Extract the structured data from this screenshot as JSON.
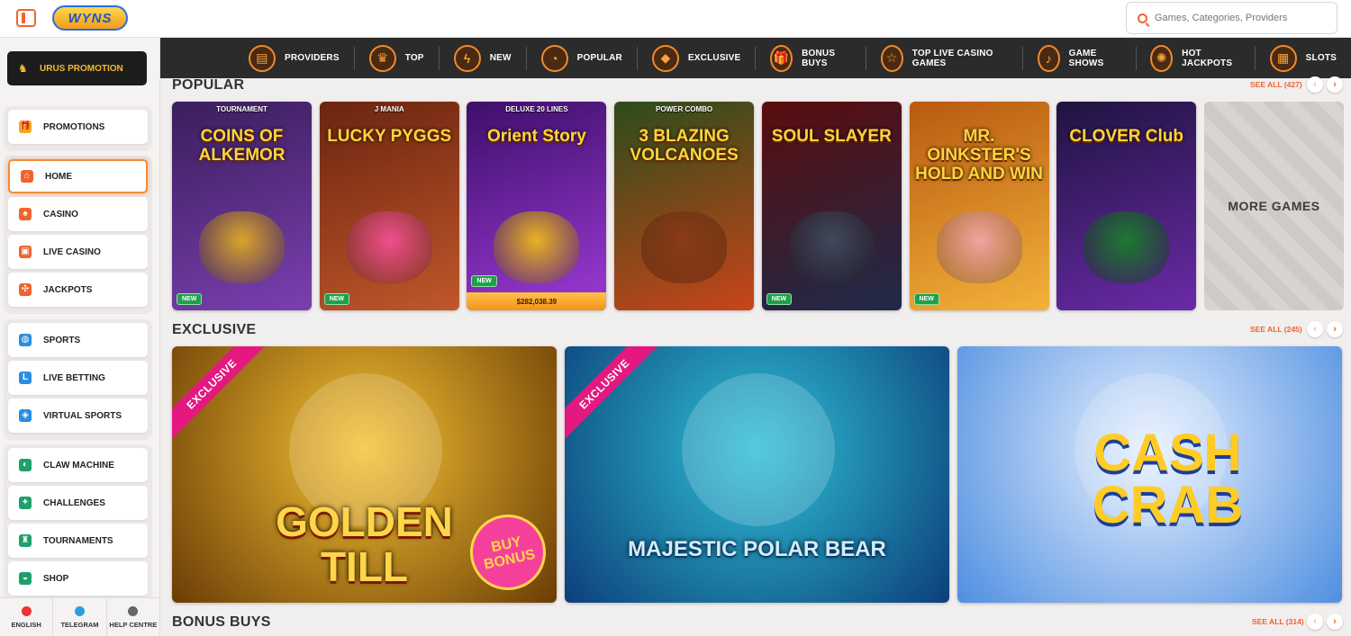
{
  "brand": {
    "logo_text": "WYNS"
  },
  "search": {
    "placeholder": "Games, Categories, Providers"
  },
  "sidebar": {
    "promo_label": "URUS PROMOTION",
    "groups": [
      [
        {
          "label": "PROMOTIONS",
          "icon": "gift-icon"
        }
      ],
      [
        {
          "label": "HOME",
          "icon": "home-icon",
          "active": true
        },
        {
          "label": "CASINO",
          "icon": "casino-icon"
        },
        {
          "label": "LIVE CASINO",
          "icon": "live-casino-icon"
        },
        {
          "label": "JACKPOTS",
          "icon": "clover-icon"
        }
      ],
      [
        {
          "label": "SPORTS",
          "icon": "ball-icon"
        },
        {
          "label": "LIVE BETTING",
          "icon": "live-icon"
        },
        {
          "label": "VIRTUAL SPORTS",
          "icon": "virtual-icon"
        }
      ],
      [
        {
          "label": "CLAW MACHINE",
          "icon": "claw-icon"
        },
        {
          "label": "CHALLENGES",
          "icon": "challenge-icon"
        },
        {
          "label": "TOURNAMENTS",
          "icon": "trophy-icon"
        },
        {
          "label": "SHOP",
          "icon": "basket-icon"
        }
      ]
    ],
    "footer": [
      {
        "label": "ENGLISH",
        "icon": "flag-icon"
      },
      {
        "label": "TELEGRAM",
        "icon": "telegram-icon"
      },
      {
        "label": "HELP CENTRE",
        "icon": "help-icon"
      }
    ]
  },
  "categories": [
    {
      "label": "PROVIDERS",
      "icon": "providers-icon"
    },
    {
      "label": "TOP",
      "icon": "crown-icon"
    },
    {
      "label": "NEW",
      "icon": "bolt-icon"
    },
    {
      "label": "POPULAR",
      "icon": "popular-icon"
    },
    {
      "label": "EXCLUSIVE",
      "icon": "diamond-icon"
    },
    {
      "label": "BONUS BUYS",
      "icon": "gift-icon"
    },
    {
      "label": "TOP LIVE CASINO GAMES",
      "icon": "star-icon"
    },
    {
      "label": "GAME SHOWS",
      "icon": "mic-icon"
    },
    {
      "label": "HOT JACKPOTS",
      "icon": "hot-icon"
    },
    {
      "label": "SLOTS",
      "icon": "slot-icon"
    }
  ],
  "popular": {
    "title": "POPULAR",
    "see_all": "SEE ALL (427)",
    "more_label": "MORE GAMES",
    "games": [
      {
        "name": "COINS OF ALKEMOR",
        "top": "TOURNAMENT",
        "badge": "NEW",
        "bg": "#3a1e5c",
        "bg2": "#7a3fb0",
        "art": "#d9a52a"
      },
      {
        "name": "LUCKY PYGGS",
        "top": "J MANIA",
        "badge": "NEW",
        "bg": "#6b2410",
        "bg2": "#c0572a",
        "art": "#f04f8e"
      },
      {
        "name": "Orient Story",
        "top": "DELUXE 20 LINES",
        "badge": "NEW",
        "prize": "$282,038.39",
        "bg": "#3e0f6a",
        "bg2": "#9c3ad6",
        "art": "#e8b320"
      },
      {
        "name": "3 BLAZING VOLCANOES",
        "top": "POWER COMBO",
        "badge": "",
        "bg": "#2c4c1a",
        "bg2": "#c8451a",
        "art": "#8a3a17"
      },
      {
        "name": "SOUL SLAYER",
        "top": "",
        "badge": "NEW",
        "bg": "#5a0d0d",
        "bg2": "#1f2a4a",
        "art": "#3f4a5c"
      },
      {
        "name": "MR. OINKSTER'S HOLD AND WIN",
        "top": "",
        "badge": "NEW",
        "bg": "#b85a10",
        "bg2": "#f3b23a",
        "art": "#f2a3a0"
      },
      {
        "name": "CLOVER Club",
        "top": "",
        "badge": "",
        "bg": "#1f1440",
        "bg2": "#6a2aa8",
        "art": "#1c7a2e"
      }
    ]
  },
  "exclusive": {
    "title": "EXCLUSIVE",
    "see_all": "SEE ALL (245)",
    "games": [
      {
        "name": "GOLDEN TILL",
        "ribbon": "EXCLUSIVE",
        "extra": "BUY BONUS",
        "bg": "#6a3c05",
        "bg2": "#f5c233",
        "fg": "#ffd54a"
      },
      {
        "name": "MAJESTIC POLAR BEAR",
        "ribbon": "EXCLUSIVE",
        "extra": "",
        "bg": "#0c3f7a",
        "bg2": "#2fc0d6",
        "fg": "#cfeeff"
      },
      {
        "name": "CASH CRAB",
        "ribbon": "",
        "extra": "",
        "bg": "#4f8fe0",
        "bg2": "#e8f1ff",
        "fg": "#ffcc26"
      }
    ]
  },
  "bonus_buys": {
    "title": "BONUS BUYS",
    "see_all": "SEE ALL (314)"
  }
}
